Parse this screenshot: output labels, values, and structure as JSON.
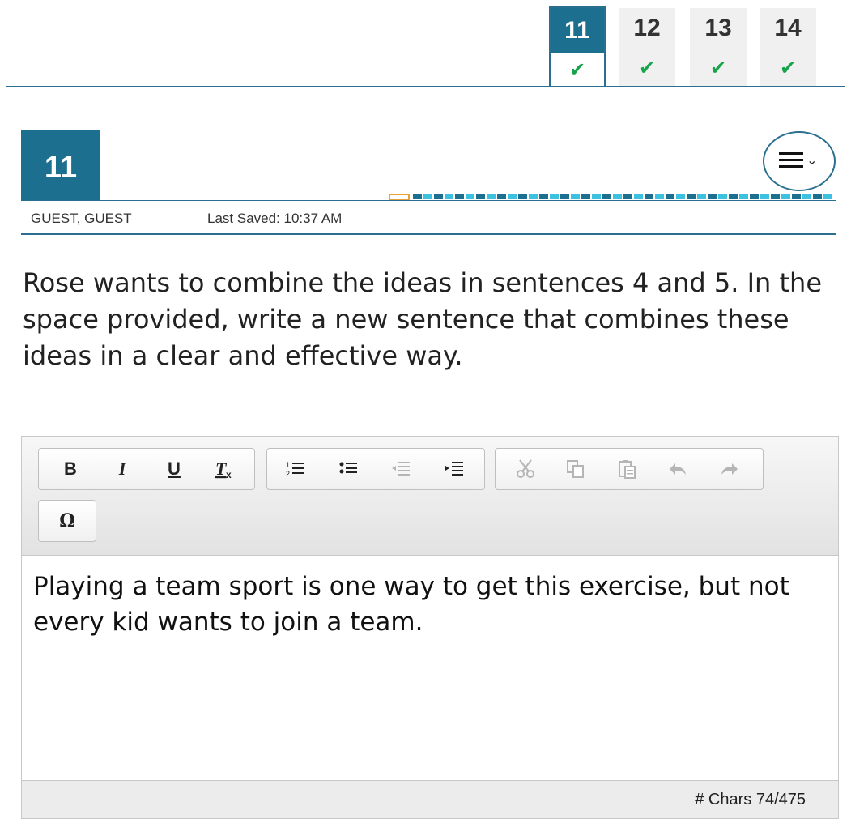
{
  "nav": {
    "tabs": [
      {
        "number": "11",
        "status": "✔",
        "active": true
      },
      {
        "number": "12",
        "status": "✔"
      },
      {
        "number": "13",
        "status": "✔"
      },
      {
        "number": "14",
        "status": "✔"
      }
    ]
  },
  "question": {
    "number": "11",
    "user": "GUEST, GUEST",
    "last_saved": "Last Saved: 10:37 AM",
    "prompt": "Rose wants to combine the ideas in sentences 4 and 5. In the space provided, write a new sentence that combines these ideas in a clear and effective way."
  },
  "colors": {
    "accent": "#1d6f8f",
    "check": "#17a34a",
    "progress_dark": "#1d6f8f",
    "progress_light": "#3cc1e0",
    "progress_current": "#e8a13c"
  },
  "editor": {
    "toolbar": {
      "bold": "B",
      "italic": "I",
      "underline": "U",
      "special_char": "Ω"
    },
    "content": "Playing a team sport is one way to get this exercise, but not every kid wants to join a team.",
    "char_count": "# Chars 74/475"
  }
}
